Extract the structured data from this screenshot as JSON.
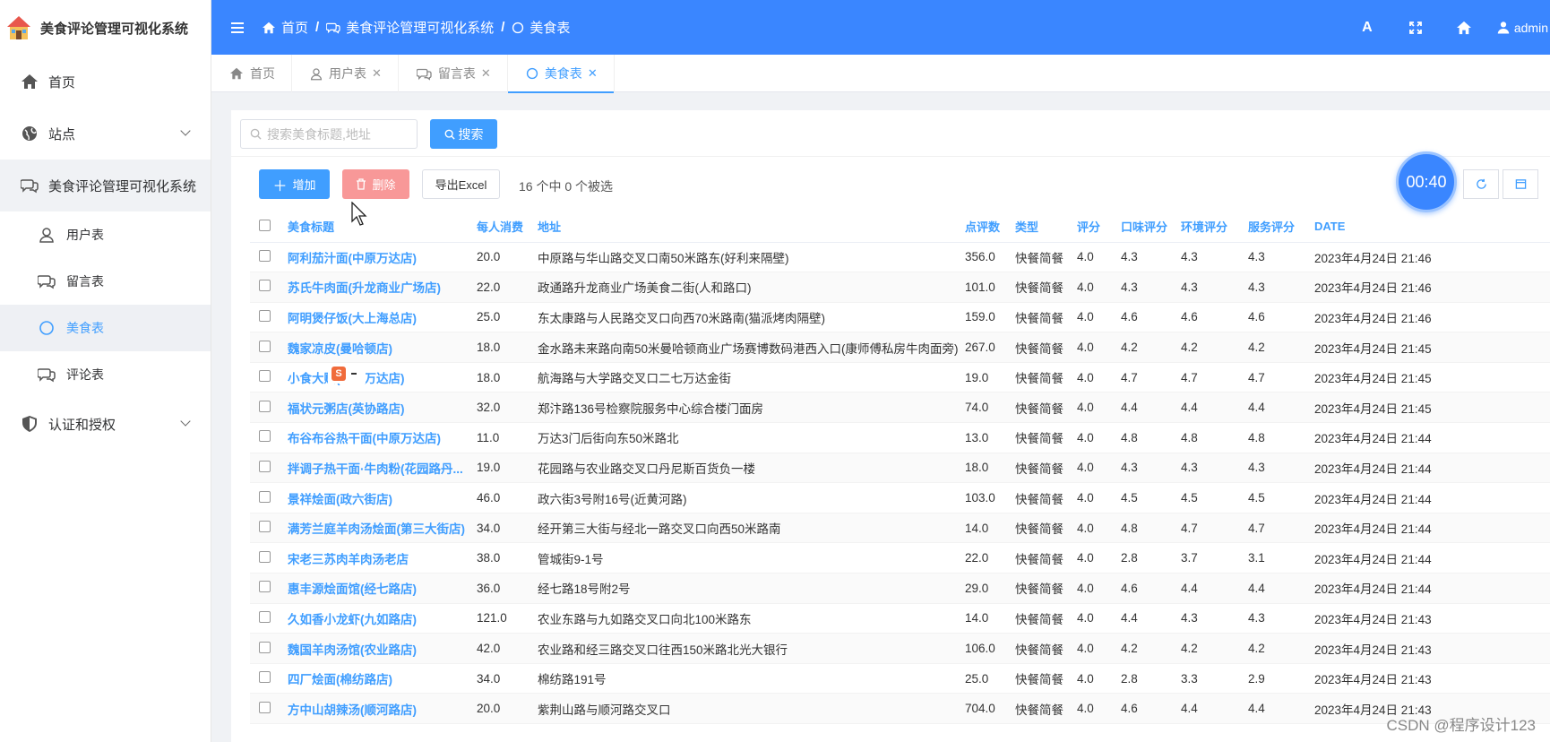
{
  "app": {
    "title": "美食评论管理可视化系统"
  },
  "sidebar": {
    "items": [
      {
        "label": "首页",
        "icon": "home-icon"
      },
      {
        "label": "站点",
        "icon": "globe-icon"
      },
      {
        "label": "美食评论管理可视化系统",
        "icon": "chat-icon"
      },
      {
        "label": "用户表",
        "icon": "user-icon"
      },
      {
        "label": "留言表",
        "icon": "chat-icon"
      },
      {
        "label": "美食表",
        "icon": "circle-icon"
      },
      {
        "label": "评论表",
        "icon": "chat-icon"
      },
      {
        "label": "认证和授权",
        "icon": "shield-icon"
      }
    ]
  },
  "header": {
    "breadcrumb": [
      "首页",
      "美食评论管理可视化系统",
      "美食表"
    ],
    "user": "admin",
    "font_icon_label": "A"
  },
  "tabs": [
    {
      "label": "首页",
      "closable": false
    },
    {
      "label": "用户表",
      "closable": true
    },
    {
      "label": "留言表",
      "closable": true
    },
    {
      "label": "美食表",
      "closable": true,
      "active": true
    }
  ],
  "search": {
    "placeholder": "搜索美食标题,地址",
    "button": "搜索"
  },
  "toolbar": {
    "add": "增加",
    "delete": "删除",
    "export": "导出Excel",
    "selection": "16 个中 0 个被选"
  },
  "timer": "00:40",
  "table": {
    "columns": [
      "美食标题",
      "每人消费",
      "地址",
      "点评数",
      "类型",
      "评分",
      "口味评分",
      "环境评分",
      "服务评分",
      "DATE"
    ],
    "rows": [
      [
        "阿利茄汁面(中原万达店)",
        "20.0",
        "中原路与华山路交叉口南50米路东(好利来隔壁)",
        "356.0",
        "快餐简餐",
        "4.0",
        "4.3",
        "4.3",
        "4.3",
        "2023年4月24日 21:46"
      ],
      [
        "苏氏牛肉面(升龙商业广场店)",
        "22.0",
        "政通路升龙商业广场美食二街(人和路口)",
        "101.0",
        "快餐简餐",
        "4.0",
        "4.3",
        "4.3",
        "4.3",
        "2023年4月24日 21:46"
      ],
      [
        "阿明煲仔饭(大上海总店)",
        "25.0",
        "东太康路与人民路交叉口向西70米路南(猫派烤肉隔壁)",
        "159.0",
        "快餐简餐",
        "4.0",
        "4.6",
        "4.6",
        "4.6",
        "2023年4月24日 21:46"
      ],
      [
        "魏家凉皮(曼哈顿店)",
        "18.0",
        "金水路未来路向南50米曼哈顿商业广场赛博数码港西入口(康师傅私房牛肉面旁)",
        "267.0",
        "快餐简餐",
        "4.0",
        "4.2",
        "4.2",
        "4.2",
        "2023年4月24日 21:45"
      ],
      [
        "小食大赋(二七万达店)",
        "18.0",
        "航海路与大学路交叉口二七万达金街",
        "19.0",
        "快餐简餐",
        "4.0",
        "4.7",
        "4.7",
        "4.7",
        "2023年4月24日 21:45"
      ],
      [
        "福状元粥店(英协路店)",
        "32.0",
        "郑汴路136号检察院服务中心综合楼门面房",
        "74.0",
        "快餐简餐",
        "4.0",
        "4.4",
        "4.4",
        "4.4",
        "2023年4月24日 21:45"
      ],
      [
        "布谷布谷热干面(中原万达店)",
        "11.0",
        "万达3门后街向东50米路北",
        "13.0",
        "快餐简餐",
        "4.0",
        "4.8",
        "4.8",
        "4.8",
        "2023年4月24日 21:44"
      ],
      [
        "拌调子热干面·牛肉粉(花园路丹...",
        "19.0",
        "花园路与农业路交叉口丹尼斯百货负一楼",
        "18.0",
        "快餐简餐",
        "4.0",
        "4.3",
        "4.3",
        "4.3",
        "2023年4月24日 21:44"
      ],
      [
        "景祥烩面(政六街店)",
        "46.0",
        "政六街3号附16号(近黄河路)",
        "103.0",
        "快餐简餐",
        "4.0",
        "4.5",
        "4.5",
        "4.5",
        "2023年4月24日 21:44"
      ],
      [
        "满芳兰庭羊肉汤烩面(第三大街店)",
        "34.0",
        "经开第三大街与经北一路交叉口向西50米路南",
        "14.0",
        "快餐简餐",
        "4.0",
        "4.8",
        "4.7",
        "4.7",
        "2023年4月24日 21:44"
      ],
      [
        "宋老三苏肉羊肉汤老店",
        "38.0",
        "管城街9-1号",
        "22.0",
        "快餐简餐",
        "4.0",
        "2.8",
        "3.7",
        "3.1",
        "2023年4月24日 21:44"
      ],
      [
        "惠丰源烩面馆(经七路店)",
        "36.0",
        "经七路18号附2号",
        "29.0",
        "快餐简餐",
        "4.0",
        "4.6",
        "4.4",
        "4.4",
        "2023年4月24日 21:44"
      ],
      [
        "久如香小龙虾(九如路店)",
        "121.0",
        "农业东路与九如路交叉口向北100米路东",
        "14.0",
        "快餐简餐",
        "4.0",
        "4.4",
        "4.3",
        "4.3",
        "2023年4月24日 21:43"
      ],
      [
        "魏国羊肉汤馆(农业路店)",
        "42.0",
        "农业路和经三路交叉口往西150米路北光大银行",
        "106.0",
        "快餐简餐",
        "4.0",
        "4.2",
        "4.2",
        "4.2",
        "2023年4月24日 21:43"
      ],
      [
        "四厂烩面(棉纺路店)",
        "34.0",
        "棉纺路191号",
        "25.0",
        "快餐简餐",
        "4.0",
        "2.8",
        "3.3",
        "2.9",
        "2023年4月24日 21:43"
      ],
      [
        "方中山胡辣汤(顺河路店)",
        "20.0",
        "紫荆山路与顺河路交叉口",
        "704.0",
        "快餐简餐",
        "4.0",
        "4.6",
        "4.4",
        "4.4",
        "2023年4月24日 21:43"
      ]
    ]
  },
  "overlay": {
    "ime": "S"
  },
  "watermark": "CSDN @程序设计123",
  "colors": {
    "primary": "#409eff",
    "header": "#3a86ff",
    "danger": "#f89898"
  }
}
